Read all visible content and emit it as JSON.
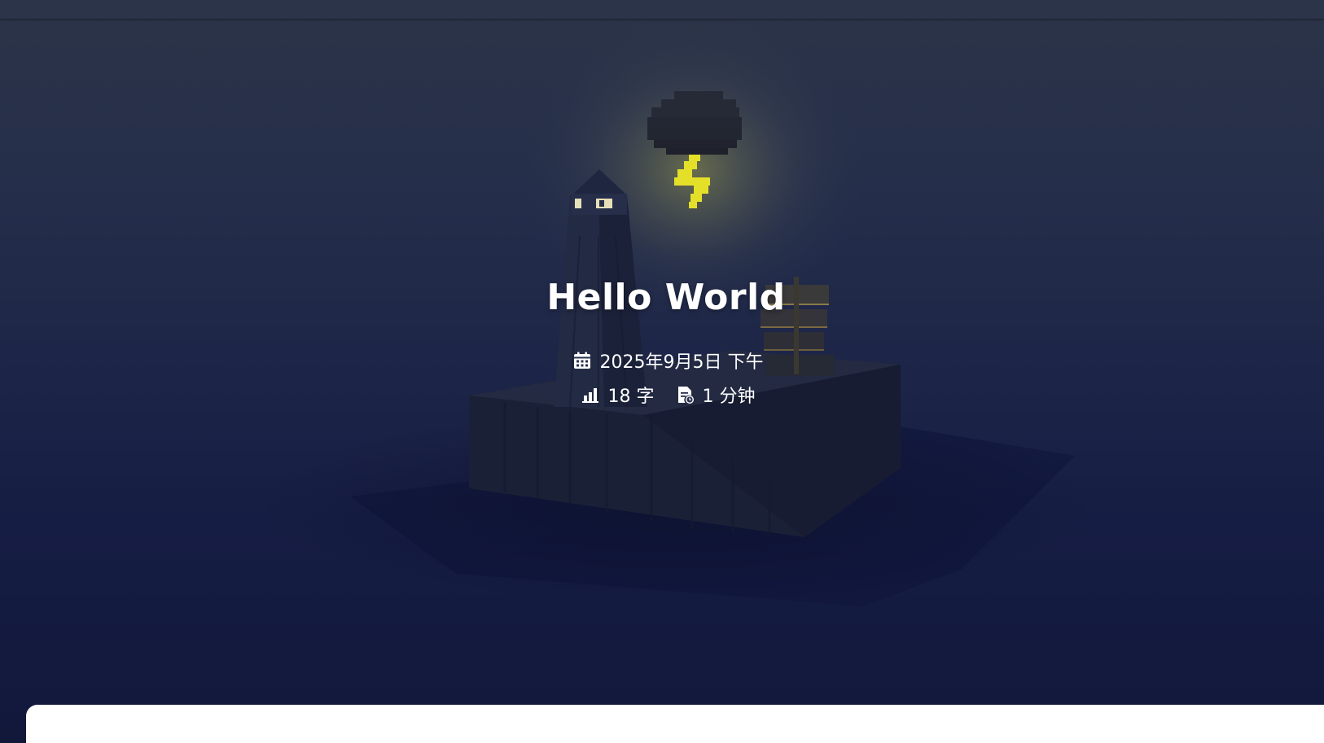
{
  "post": {
    "title": "Hello World",
    "date": "2025年9月5日 下午",
    "word_count": "18 字",
    "read_time": "1 分钟"
  },
  "icons": {
    "date": "calendar-icon",
    "words": "bar-chart-icon",
    "time": "reading-time-icon"
  },
  "colors": {
    "topbar": "#2b3448",
    "hero_top": "#2c3448",
    "hero_bottom": "#12183a",
    "text": "#ffffff",
    "lightning": "#e8e22a",
    "card": "#ffffff"
  }
}
